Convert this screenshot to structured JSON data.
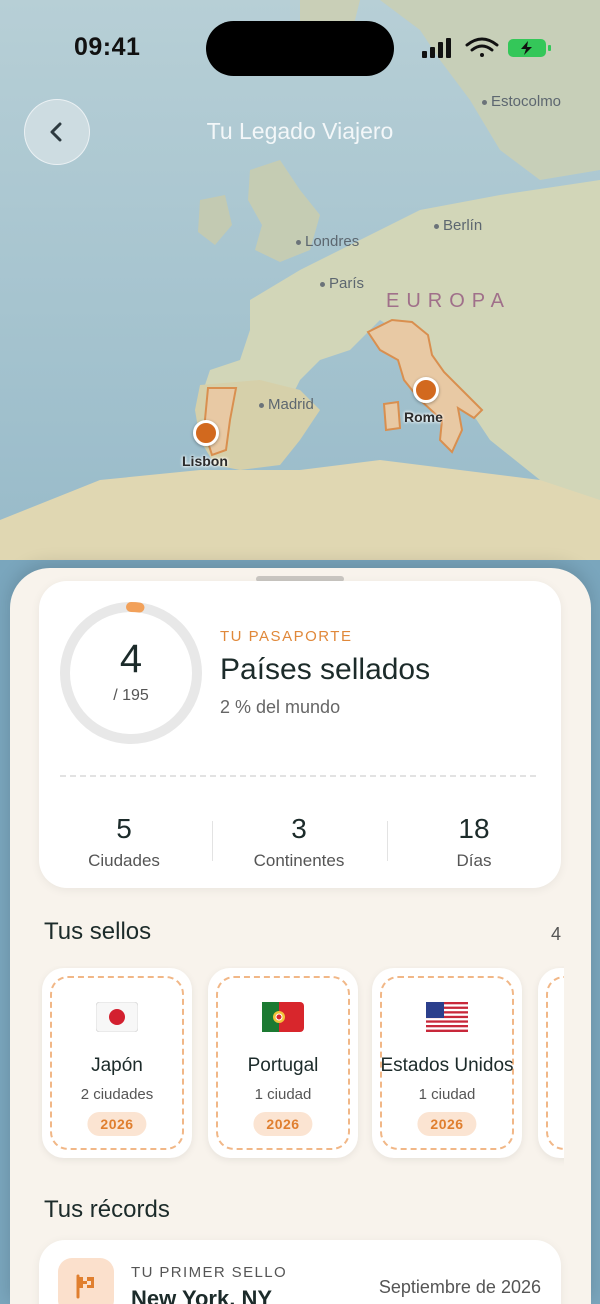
{
  "status_bar": {
    "time": "09:41"
  },
  "nav": {
    "title": "Tu Legado Viajero"
  },
  "map": {
    "cities": [
      {
        "name": "Estocolmo"
      },
      {
        "name": "Londres"
      },
      {
        "name": "Berlín"
      },
      {
        "name": "París"
      },
      {
        "name": "Madrid"
      }
    ],
    "region": "EUROPA",
    "pins": [
      {
        "name": "Rome"
      },
      {
        "name": "Lisbon"
      }
    ],
    "colors": {
      "pin": "#d2691e",
      "highlight_country": "#e8a86a"
    }
  },
  "summary": {
    "count": "4",
    "total": "/ 195",
    "progress_fraction": 0.0205,
    "eyebrow": "TU PASAPORTE",
    "title": "Países sellados",
    "subtitle": "2 % del mundo",
    "stats": [
      {
        "value": "5",
        "label": "Ciudades"
      },
      {
        "value": "3",
        "label": "Continentes"
      },
      {
        "value": "18",
        "label": "Días"
      }
    ]
  },
  "stamps_section": {
    "title": "Tus sellos",
    "count": "4",
    "items": [
      {
        "flag": "japan-flag-icon",
        "name": "Japón",
        "cities": "2 ciudades",
        "year": "2026"
      },
      {
        "flag": "portugal-flag-icon",
        "name": "Portugal",
        "cities": "1 ciudad",
        "year": "2026"
      },
      {
        "flag": "usa-flag-icon",
        "name": "Estados Unidos",
        "cities": "1 ciudad",
        "year": "2026"
      }
    ]
  },
  "records_section": {
    "title": "Tus récords",
    "first": {
      "eyebrow": "TU PRIMER SELLO",
      "title": "New York, NY",
      "date": "Septiembre de 2026"
    }
  },
  "accent_color": "#e0883a"
}
